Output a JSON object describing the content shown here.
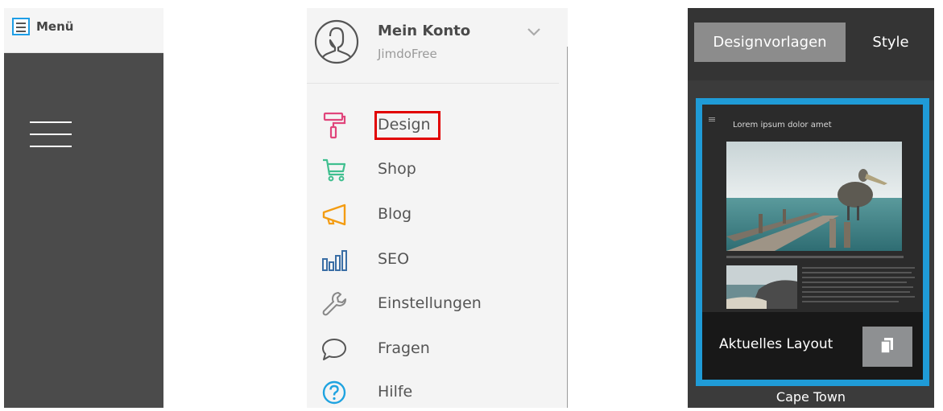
{
  "menu_panel": {
    "toggle_label": "Menü"
  },
  "nav_panel": {
    "account": {
      "name": "Mein Konto",
      "plan": "JimdoFree"
    },
    "items": [
      {
        "label": "Design",
        "icon": "paint-roller-icon",
        "color": "#e0457b"
      },
      {
        "label": "Shop",
        "icon": "shopping-cart-icon",
        "color": "#3fbf8f"
      },
      {
        "label": "Blog",
        "icon": "megaphone-icon",
        "color": "#f39c12"
      },
      {
        "label": "SEO",
        "icon": "bar-chart-icon",
        "color": "#3a6ea5"
      },
      {
        "label": "Einstellungen",
        "icon": "wrench-icon",
        "color": "#888888"
      },
      {
        "label": "Fragen",
        "icon": "speech-bubble-icon",
        "color": "#555555"
      },
      {
        "label": "Hilfe",
        "icon": "question-circle-icon",
        "color": "#1fa3e0"
      }
    ],
    "highlighted_item": "Design",
    "highlight_color": "#e10000"
  },
  "design_panel": {
    "tabs": [
      {
        "label": "Designvorlagen",
        "active": true
      },
      {
        "label": "Style",
        "active": false
      }
    ],
    "template": {
      "preview_title": "Lorem ipsum dolor amet",
      "overlay_label": "Aktuelles Layout",
      "name": "Cape Town"
    },
    "accent_color": "#1f9bd7"
  }
}
